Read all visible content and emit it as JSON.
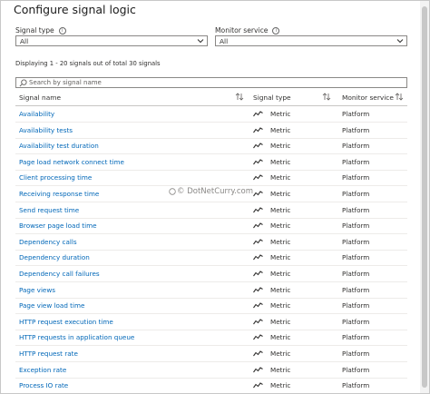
{
  "panel": {
    "title": "Configure signal logic"
  },
  "filters": {
    "signal_type": {
      "label": "Signal type",
      "value": "All"
    },
    "monitor_service": {
      "label": "Monitor service",
      "value": "All"
    }
  },
  "summary": "Displaying 1 - 20 signals out of total 30 signals",
  "search": {
    "placeholder": "Search by signal name"
  },
  "table": {
    "headers": {
      "signal_name": "Signal name",
      "signal_type": "Signal type",
      "monitor_service": "Monitor service"
    },
    "rows": [
      {
        "name": "Availability",
        "type": "Metric",
        "service": "Platform"
      },
      {
        "name": "Availability tests",
        "type": "Metric",
        "service": "Platform"
      },
      {
        "name": "Availability test duration",
        "type": "Metric",
        "service": "Platform"
      },
      {
        "name": "Page load network connect time",
        "type": "Metric",
        "service": "Platform"
      },
      {
        "name": "Client processing time",
        "type": "Metric",
        "service": "Platform"
      },
      {
        "name": "Receiving response time",
        "type": "Metric",
        "service": "Platform"
      },
      {
        "name": "Send request time",
        "type": "Metric",
        "service": "Platform"
      },
      {
        "name": "Browser page load time",
        "type": "Metric",
        "service": "Platform"
      },
      {
        "name": "Dependency calls",
        "type": "Metric",
        "service": "Platform"
      },
      {
        "name": "Dependency duration",
        "type": "Metric",
        "service": "Platform"
      },
      {
        "name": "Dependency call failures",
        "type": "Metric",
        "service": "Platform"
      },
      {
        "name": "Page views",
        "type": "Metric",
        "service": "Platform"
      },
      {
        "name": "Page view load time",
        "type": "Metric",
        "service": "Platform"
      },
      {
        "name": "HTTP request execution time",
        "type": "Metric",
        "service": "Platform"
      },
      {
        "name": "HTTP requests in application queue",
        "type": "Metric",
        "service": "Platform"
      },
      {
        "name": "HTTP request rate",
        "type": "Metric",
        "service": "Platform"
      },
      {
        "name": "Exception rate",
        "type": "Metric",
        "service": "Platform"
      },
      {
        "name": "Process IO rate",
        "type": "Metric",
        "service": "Platform"
      }
    ]
  },
  "watermark": "© DotNetCurry.com"
}
